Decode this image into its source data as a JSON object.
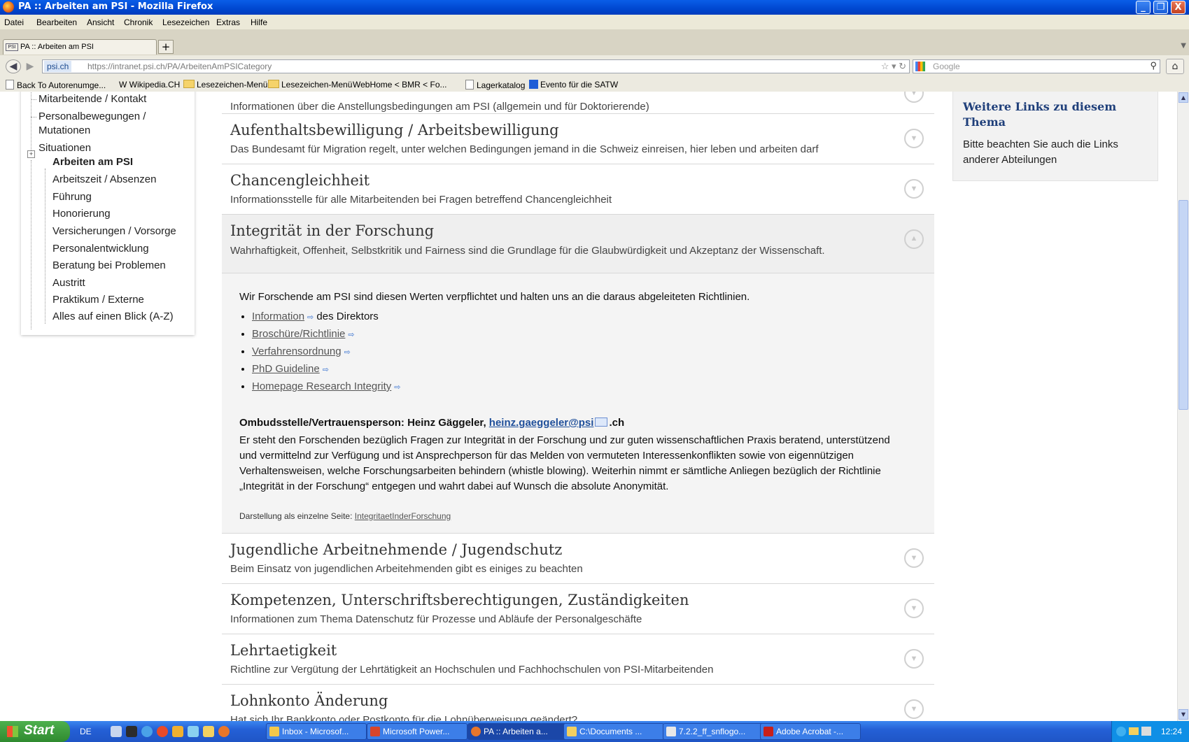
{
  "window": {
    "title": "PA :: Arbeiten am PSI - Mozilla Firefox",
    "controls": [
      "_",
      "❐",
      "X"
    ]
  },
  "menu": [
    "Datei",
    "Bearbeiten",
    "Ansicht",
    "Chronik",
    "Lesezeichen",
    "Extras",
    "Hilfe"
  ],
  "tabs": {
    "active_label": "PA :: Arbeiten am PSI",
    "favicon": "PSI",
    "new_tab": "+"
  },
  "nav": {
    "identity": "psi.ch",
    "url": "https://intranet.psi.ch/PA/ArbeitenAmPSICategory",
    "search_placeholder": "Google"
  },
  "bookmarks": [
    "Back To Autorenumge...",
    "W Wikipedia.CH",
    "Lesezeichen-Menü",
    "Lesezeichen-Menü",
    "WebHome < BMR < Fo...",
    "Lagerkatalog",
    "Evento für die SATW"
  ],
  "sidebar": {
    "items": [
      "Mitarbeitende / Kontakt",
      "Personalbewegungen /",
      "Mutationen",
      "Situationen"
    ],
    "active": "Arbeiten am PSI",
    "sub_items": [
      "Arbeitszeit / Absenzen",
      "Führung",
      "Honorierung",
      "Versicherungen / Vorsorge",
      "Personalentwicklung",
      "Beratung bei Problemen",
      "Austritt",
      "Praktikum / Externe",
      "Alles auf einen Blick (A-Z)"
    ]
  },
  "accordion": {
    "top_partial_sub": "Informationen über die Anstellungsbedingungen am PSI (allgemein und für Doktorierende)",
    "items": [
      {
        "title": "Aufenthaltsbewilligung / Arbeitsbewilligung",
        "sub": "Das Bundesamt für Migration regelt, unter welchen Bedingungen jemand in die Schweiz einreisen, hier leben und arbeiten darf"
      },
      {
        "title": "Chancengleichheit",
        "sub": "Informationsstelle für alle Mitarbeitenden bei Fragen betreffend Chancengleichheit"
      },
      {
        "title": "Integrität in der Forschung",
        "sub": "Wahrhaftigkeit, Offenheit, Selbstkritik und Fairness sind die Grundlage für die Glaubwürdigkeit und Akzeptanz der Wissenschaft."
      },
      {
        "title": "Jugendliche Arbeitnehmende / Jugendschutz",
        "sub": "Beim Einsatz von jugendlichen Arbeitehmenden gibt es einiges zu beachten"
      },
      {
        "title": "Kompetenzen, Unterschriftsberechtigungen, Zuständigkeiten",
        "sub": "Informationen zum Thema Datenschutz für Prozesse und Abläufe der Personalgeschäfte"
      },
      {
        "title": "Lehrtaetigkeit",
        "sub": "Richtline zur Vergütung der Lehrtätigkeit an Hochschulen und Fachhochschulen von PSI-Mitarbeitenden"
      },
      {
        "title": "Lohnkonto Änderung",
        "sub": "Hat sich Ihr Bankkonto oder Postkonto für die Lohnüberweisung geändert?"
      }
    ],
    "open": {
      "intro": "Wir Forschende am PSI sind diesen Werten verpflichtet und halten uns an die daraus abgeleiteten Richtlinien.",
      "links": [
        {
          "text": "Information",
          "suffix": " des Direktors"
        },
        {
          "text": "Broschüre/Richtlinie",
          "suffix": ""
        },
        {
          "text": "Verfahrensordnung",
          "suffix": ""
        },
        {
          "text": "PhD Guideline",
          "suffix": ""
        },
        {
          "text": "Homepage Research Integrity",
          "suffix": ""
        }
      ],
      "ombuds_label": "Ombudsstelle/Vertrauensperson: Heinz Gäggeler, ",
      "ombuds_email": "heinz.gaeggeler@psi",
      "ombuds_email_tld": ".ch",
      "paragraph": "Er steht den Forschenden bezüglich Fragen zur Integrität in der Forschung und zur guten wissenschaftlichen Praxis beratend, unterstützend und vermittelnd zur Verfügung und ist Ansprechperson für das Melden von vermuteten Interessenkonflikten sowie von eigennützigen Verhaltensweisen, welche Forschungsarbeiten behindern (whistle blowing). Weiterhin nimmt er sämtliche Anliegen bezüglich der Richtlinie „Integrität in der Forschung“ entgegen und wahrt dabei auf Wunsch die absolute Anonymität.",
      "single_label": "Darstellung als einzelne Seite: ",
      "single_link": "IntegritaetInderForschung"
    }
  },
  "rightbox": {
    "heading": "Weitere Links zu diesem Thema",
    "text": "Bitte beachten Sie auch die Links anderer Abteilungen"
  },
  "taskbar": {
    "start": "Start",
    "lang": "DE",
    "buttons": [
      "Inbox - Microsof...",
      "Microsoft Power...",
      "PA :: Arbeiten a...",
      "C:\\Documents ...",
      "7.2.2_ff_snflogo...",
      "Adobe Acrobat -..."
    ],
    "clock": "12:24"
  }
}
